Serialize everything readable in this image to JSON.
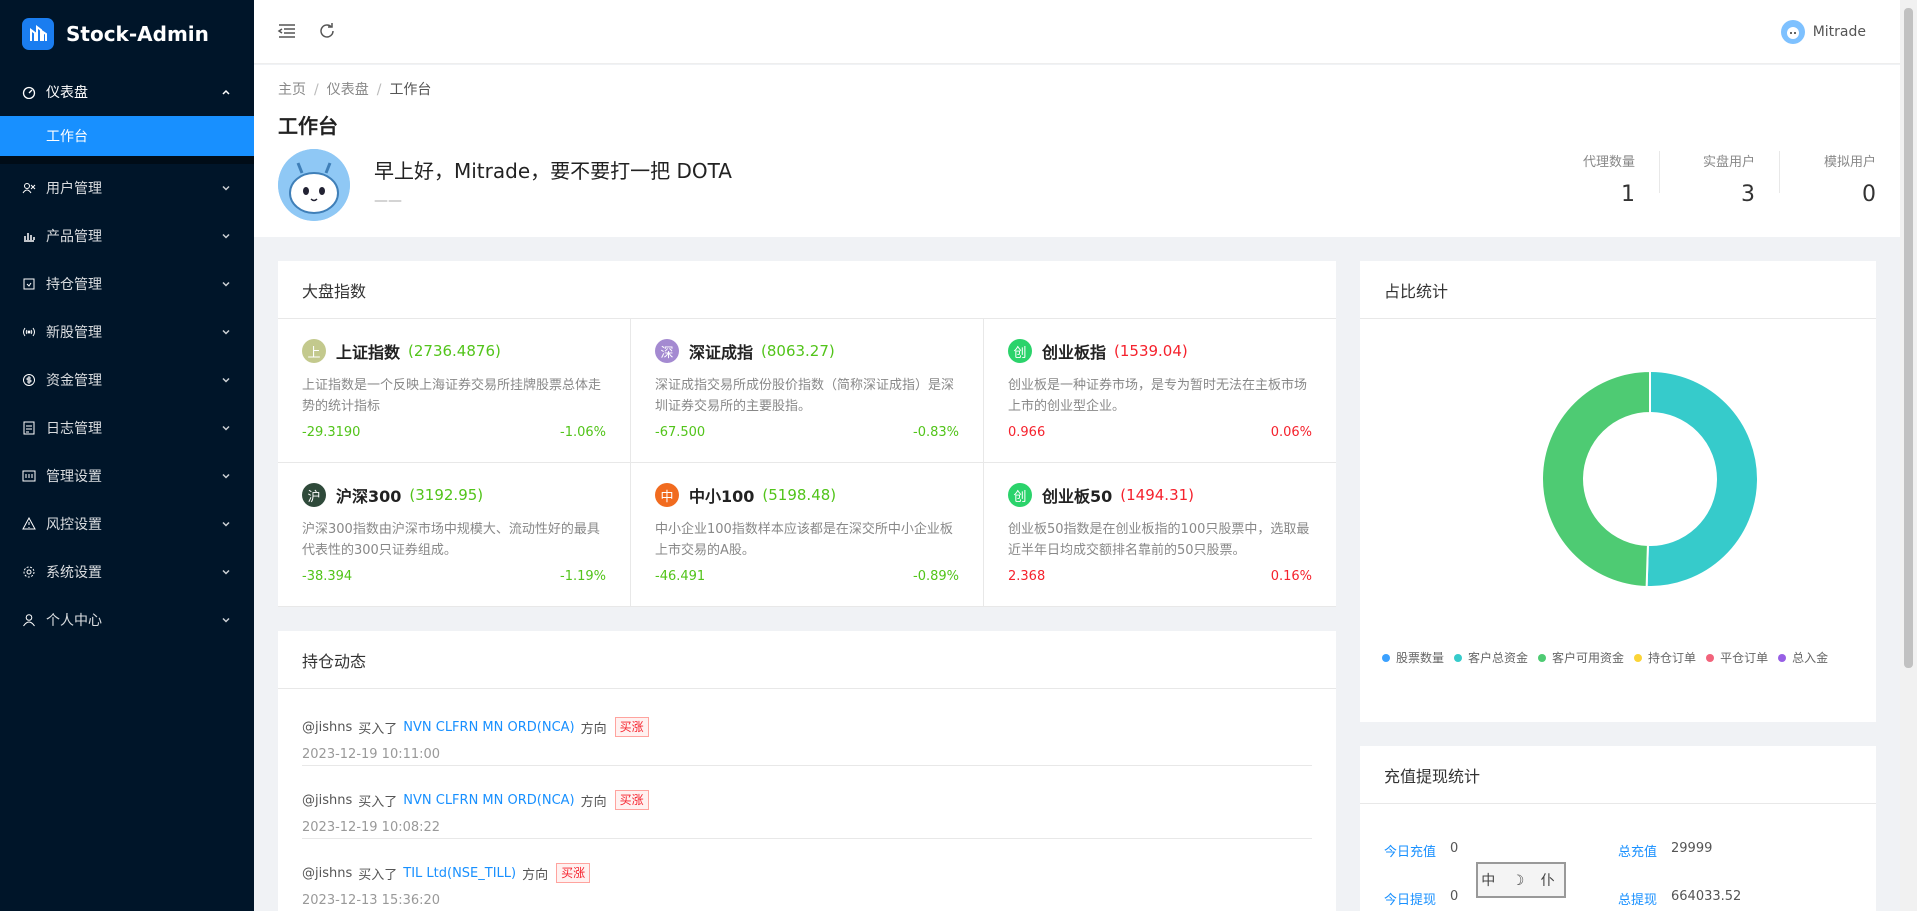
{
  "app": {
    "title": "Stock-Admin"
  },
  "sidebar": {
    "open_group": {
      "label": "仪表盘",
      "icon": "dashboard-icon"
    },
    "active_item": "工作台",
    "items": [
      {
        "label": "用户管理",
        "icon": "users-icon"
      },
      {
        "label": "产品管理",
        "icon": "bar-chart-icon"
      },
      {
        "label": "持仓管理",
        "icon": "position-icon"
      },
      {
        "label": "新股管理",
        "icon": "broadcast-icon"
      },
      {
        "label": "资金管理",
        "icon": "dollar-icon"
      },
      {
        "label": "日志管理",
        "icon": "log-icon"
      },
      {
        "label": "管理设置",
        "icon": "settings-panel-icon"
      },
      {
        "label": "风控设置",
        "icon": "warning-icon"
      },
      {
        "label": "系统设置",
        "icon": "gear-icon"
      },
      {
        "label": "个人中心",
        "icon": "user-icon"
      }
    ]
  },
  "header": {
    "user_name": "Mitrade"
  },
  "breadcrumb": [
    "主页",
    "仪表盘",
    "工作台"
  ],
  "page_title": "工作台",
  "greeting": {
    "text": "早上好，Mitrade，要不要打一把 DOTA",
    "sub": "——"
  },
  "stats": [
    {
      "label": "代理数量",
      "value": "1"
    },
    {
      "label": "实盘用户",
      "value": "3"
    },
    {
      "label": "模拟用户",
      "value": "0"
    }
  ],
  "market": {
    "title": "大盘指数",
    "indices": [
      {
        "badge": "上",
        "badge_color": "#c3c98d",
        "name": "上证指数",
        "price": "(2736.4876)",
        "trend": "green",
        "desc": "上证指数是一个反映上海证券交易所挂牌股票总体走势的统计指标",
        "change": "-29.3190",
        "pct": "-1.06%"
      },
      {
        "badge": "深",
        "badge_color": "#a48ad1",
        "name": "深证成指",
        "price": "(8063.27)",
        "trend": "green",
        "desc": "深证成指交易所成份股价指数（简称深证成指）是深圳证券交易所的主要股指。",
        "change": "-67.500",
        "pct": "-0.83%"
      },
      {
        "badge": "创",
        "badge_color": "#2bd36b",
        "name": "创业板指",
        "price": "(1539.04)",
        "trend": "red",
        "desc": "创业板是一种证券市场，是专为暂时无法在主板市场上市的创业型企业。",
        "change": "0.966",
        "pct": "0.06%"
      },
      {
        "badge": "沪",
        "badge_color": "#2f4a3a",
        "name": "沪深300",
        "price": "(3192.95)",
        "trend": "green",
        "desc": "沪深300指数由沪深市场中规模大、流动性好的最具代表性的300只证券组成。",
        "change": "-38.394",
        "pct": "-1.19%"
      },
      {
        "badge": "中",
        "badge_color": "#f16b1f",
        "name": "中小100",
        "price": "(5198.48)",
        "trend": "green",
        "desc": "中小企业100指数样本应该都是在深交所中小企业板上市交易的A股。",
        "change": "-46.491",
        "pct": "-0.89%"
      },
      {
        "badge": "创",
        "badge_color": "#2bd36b",
        "name": "创业板50",
        "price": "(1494.31)",
        "trend": "red",
        "desc": "创业板50指数是在创业板指的100只股票中，选取最近半年日均成交额排名靠前的50只股票。",
        "change": "2.368",
        "pct": "0.16%"
      }
    ]
  },
  "positions": {
    "title": "持仓动态",
    "items": [
      {
        "user": "@jishns",
        "action": "买入了",
        "stock": "NVN CLFRN MN ORD(NCA)",
        "dir_label": "方向",
        "tag": "买涨",
        "time": "2023-12-19 10:11:00"
      },
      {
        "user": "@jishns",
        "action": "买入了",
        "stock": "NVN CLFRN MN ORD(NCA)",
        "dir_label": "方向",
        "tag": "买涨",
        "time": "2023-12-19 10:08:22"
      },
      {
        "user": "@jishns",
        "action": "买入了",
        "stock": "TIL Ltd(NSE_TILL)",
        "dir_label": "方向",
        "tag": "买涨",
        "time": "2023-12-13 15:36:20"
      }
    ]
  },
  "ratio": {
    "title": "占比统计",
    "chart_data": {
      "type": "pie",
      "donut": true,
      "labels": [
        "股票数量",
        "客户总资金",
        "客户可用资金",
        "持仓订单",
        "平仓订单",
        "总入金"
      ],
      "colors": [
        "#3ba1ff",
        "#36cbcb",
        "#4ecb73",
        "#fbd437",
        "#f2637b",
        "#975fe5"
      ],
      "values": [
        0,
        50.5,
        49.5,
        0,
        0,
        0
      ]
    }
  },
  "recharge": {
    "title": "充值提现统计",
    "rows": [
      {
        "label": "今日充值",
        "value": "0"
      },
      {
        "label": "总充值",
        "value": "29999"
      },
      {
        "label": "今日提现",
        "value": "0"
      },
      {
        "label": "总提现",
        "value": "664033.52"
      }
    ],
    "stamp": "中 ☽ 仆"
  }
}
